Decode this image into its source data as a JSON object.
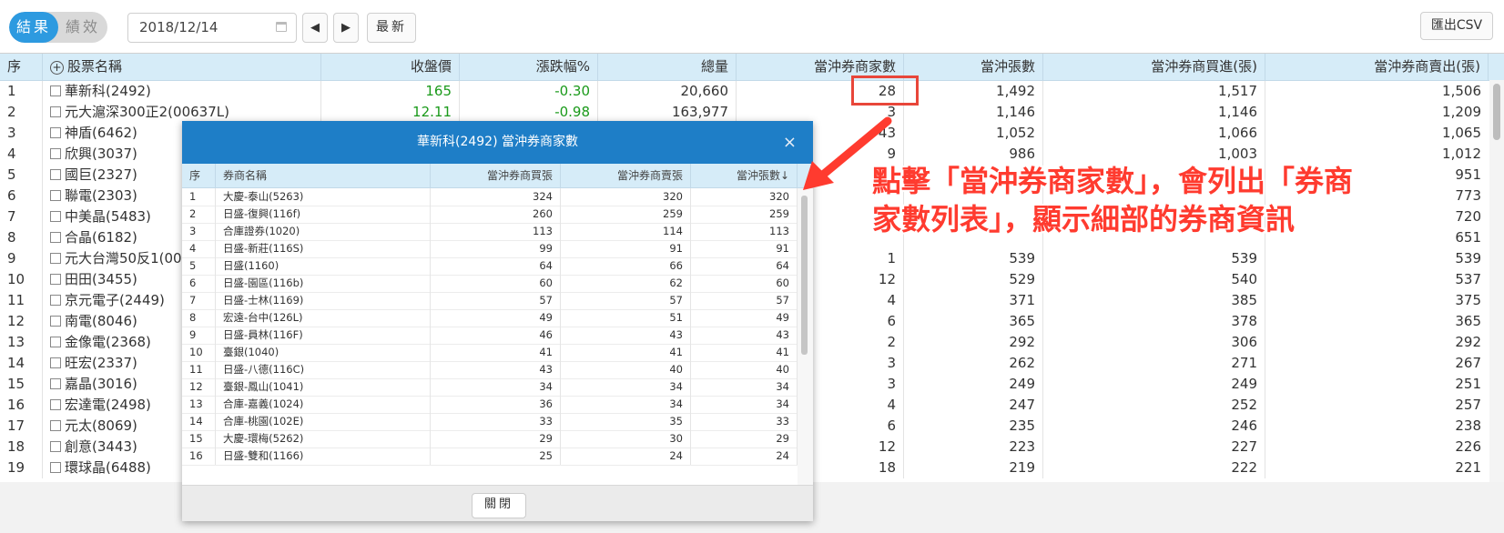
{
  "toolbar": {
    "toggle_on": "結果",
    "toggle_off": "績效",
    "date_value": "2018/12/14",
    "prev_label": "◀",
    "next_label": "▶",
    "refresh_label": "最新",
    "export_label": "匯出CSV"
  },
  "grid": {
    "headers": {
      "seq": "序",
      "name": "股票名稱",
      "close": "收盤價",
      "change": "漲跌幅%",
      "volume": "總量",
      "brokers": "當沖券商家數",
      "lots": "當沖張數",
      "buy": "當沖券商買進(張)",
      "sell": "當沖券商賣出(張)"
    },
    "rows": [
      {
        "seq": "1",
        "name": "華新科(2492)",
        "close": "165",
        "change": "-0.30",
        "volume": "20,660",
        "brokers": "28",
        "lots": "1,492",
        "buy": "1,517",
        "sell": "1,506"
      },
      {
        "seq": "2",
        "name": "元大滬深300正2(00637L)",
        "close": "12.11",
        "change": "-0.98",
        "volume": "163,977",
        "brokers": "3",
        "lots": "1,146",
        "buy": "1,146",
        "sell": "1,209"
      },
      {
        "seq": "3",
        "name": "神盾(6462)",
        "close": "",
        "change": "",
        "volume": "",
        "brokers": "43",
        "lots": "1,052",
        "buy": "1,066",
        "sell": "1,065"
      },
      {
        "seq": "4",
        "name": "欣興(3037)",
        "close": "",
        "change": "",
        "volume": "",
        "brokers": "9",
        "lots": "986",
        "buy": "1,003",
        "sell": "1,012"
      },
      {
        "seq": "5",
        "name": "國巨(2327)",
        "close": "",
        "change": "",
        "volume": "",
        "brokers": "",
        "lots": "",
        "buy": "",
        "sell": "951"
      },
      {
        "seq": "6",
        "name": "聯電(2303)",
        "close": "",
        "change": "",
        "volume": "",
        "brokers": "",
        "lots": "",
        "buy": "",
        "sell": "773"
      },
      {
        "seq": "7",
        "name": "中美晶(5483)",
        "close": "",
        "change": "",
        "volume": "",
        "brokers": "",
        "lots": "",
        "buy": "",
        "sell": "720"
      },
      {
        "seq": "8",
        "name": "合晶(6182)",
        "close": "",
        "change": "",
        "volume": "",
        "brokers": "",
        "lots": "",
        "buy": "",
        "sell": "651"
      },
      {
        "seq": "9",
        "name": "元大台灣50反1(00",
        "close": "",
        "change": "",
        "volume": "",
        "brokers": "1",
        "lots": "539",
        "buy": "539",
        "sell": "539"
      },
      {
        "seq": "10",
        "name": "田田(3455)",
        "close": "",
        "change": "",
        "volume": "",
        "brokers": "12",
        "lots": "529",
        "buy": "540",
        "sell": "537"
      },
      {
        "seq": "11",
        "name": "京元電子(2449)",
        "close": "",
        "change": "",
        "volume": "",
        "brokers": "4",
        "lots": "371",
        "buy": "385",
        "sell": "375"
      },
      {
        "seq": "12",
        "name": "南電(8046)",
        "close": "",
        "change": "",
        "volume": "",
        "brokers": "6",
        "lots": "365",
        "buy": "378",
        "sell": "365"
      },
      {
        "seq": "13",
        "name": "金像電(2368)",
        "close": "",
        "change": "",
        "volume": "",
        "brokers": "2",
        "lots": "292",
        "buy": "306",
        "sell": "292"
      },
      {
        "seq": "14",
        "name": "旺宏(2337)",
        "close": "",
        "change": "",
        "volume": "",
        "brokers": "3",
        "lots": "262",
        "buy": "271",
        "sell": "267"
      },
      {
        "seq": "15",
        "name": "嘉晶(3016)",
        "close": "",
        "change": "",
        "volume": "",
        "brokers": "3",
        "lots": "249",
        "buy": "249",
        "sell": "251"
      },
      {
        "seq": "16",
        "name": "宏達電(2498)",
        "close": "",
        "change": "",
        "volume": "",
        "brokers": "4",
        "lots": "247",
        "buy": "252",
        "sell": "257"
      },
      {
        "seq": "17",
        "name": "元太(8069)",
        "close": "",
        "change": "",
        "volume": "",
        "brokers": "6",
        "lots": "235",
        "buy": "246",
        "sell": "238"
      },
      {
        "seq": "18",
        "name": "創意(3443)",
        "close": "",
        "change": "",
        "volume": "",
        "brokers": "12",
        "lots": "223",
        "buy": "227",
        "sell": "226"
      },
      {
        "seq": "19",
        "name": "環球晶(6488)",
        "close": "",
        "change": "",
        "volume": "",
        "brokers": "18",
        "lots": "219",
        "buy": "222",
        "sell": "221"
      }
    ]
  },
  "modal": {
    "title": "華新科(2492) 當沖券商家數",
    "close_icon": "×",
    "headers": {
      "seq": "序",
      "broker": "券商名稱",
      "buy": "當沖券商買張",
      "sell": "當沖券商賣張",
      "lots": "當沖張數↓"
    },
    "rows": [
      {
        "seq": "1",
        "broker": "大慶-泰山(5263)",
        "buy": "324",
        "sell": "320",
        "lots": "320"
      },
      {
        "seq": "2",
        "broker": "日盛-復興(116f)",
        "buy": "260",
        "sell": "259",
        "lots": "259"
      },
      {
        "seq": "3",
        "broker": "合庫證券(1020)",
        "buy": "113",
        "sell": "114",
        "lots": "113"
      },
      {
        "seq": "4",
        "broker": "日盛-新莊(116S)",
        "buy": "99",
        "sell": "91",
        "lots": "91"
      },
      {
        "seq": "5",
        "broker": "日盛(1160)",
        "buy": "64",
        "sell": "66",
        "lots": "64"
      },
      {
        "seq": "6",
        "broker": "日盛-園區(116b)",
        "buy": "60",
        "sell": "62",
        "lots": "60"
      },
      {
        "seq": "7",
        "broker": "日盛-士林(1169)",
        "buy": "57",
        "sell": "57",
        "lots": "57"
      },
      {
        "seq": "8",
        "broker": "宏遠-台中(126L)",
        "buy": "49",
        "sell": "51",
        "lots": "49"
      },
      {
        "seq": "9",
        "broker": "日盛-員林(116F)",
        "buy": "46",
        "sell": "43",
        "lots": "43"
      },
      {
        "seq": "10",
        "broker": "臺銀(1040)",
        "buy": "41",
        "sell": "41",
        "lots": "41"
      },
      {
        "seq": "11",
        "broker": "日盛-八德(116C)",
        "buy": "43",
        "sell": "40",
        "lots": "40"
      },
      {
        "seq": "12",
        "broker": "臺銀-鳳山(1041)",
        "buy": "34",
        "sell": "34",
        "lots": "34"
      },
      {
        "seq": "13",
        "broker": "合庫-嘉義(1024)",
        "buy": "36",
        "sell": "34",
        "lots": "34"
      },
      {
        "seq": "14",
        "broker": "合庫-桃園(102E)",
        "buy": "33",
        "sell": "35",
        "lots": "33"
      },
      {
        "seq": "15",
        "broker": "大慶-環梅(5262)",
        "buy": "29",
        "sell": "30",
        "lots": "29"
      },
      {
        "seq": "16",
        "broker": "日盛-雙和(1166)",
        "buy": "25",
        "sell": "24",
        "lots": "24"
      }
    ],
    "close_button": "關閉"
  },
  "annotation": {
    "line1": "點擊「當沖券商家數」，會列出「券商",
    "line2": "家數列表」，顯示細部的券商資訊",
    "color": "#ff3b2f"
  },
  "colors": {
    "accent": "#2d9ae0",
    "modal_header": "#1e7ec7",
    "table_header": "#d6ecf8",
    "positive": "#1a9a1a",
    "highlight": "#e8463a"
  }
}
